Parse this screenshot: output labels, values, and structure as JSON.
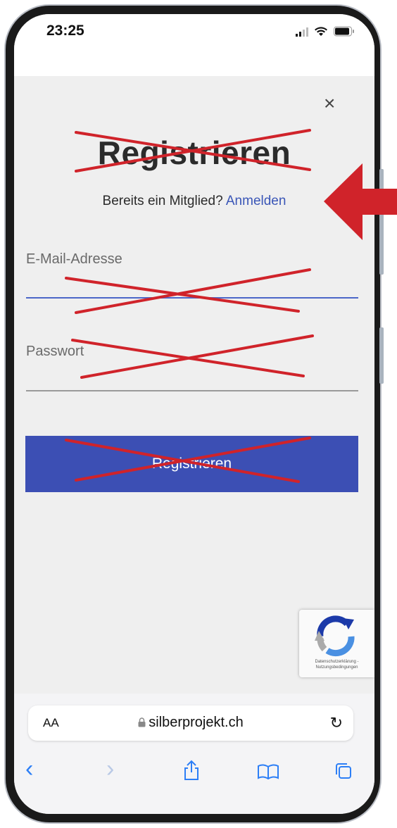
{
  "status_bar": {
    "time": "23:25",
    "icons": [
      "signal-icon",
      "wifi-icon",
      "battery-icon"
    ]
  },
  "form": {
    "close_symbol": "×",
    "title": "Registrieren",
    "member_prompt": "Bereits ein Mitglied?",
    "login_link": "Anmelden",
    "email_label": "E-Mail-Adresse",
    "password_label": "Passwort",
    "submit_label": "Registrieren"
  },
  "recaptcha": {
    "line1": "Datenschutzerklärung -",
    "line2": "Nutzungsbedingungen"
  },
  "browser": {
    "text_size_label": "AA",
    "url": "silberprojekt.ch",
    "reload_symbol": "↻",
    "toolbar": {
      "back_symbol": "‹",
      "forward_symbol": "›",
      "share_symbol": "⇪",
      "bookmarks_symbol": "📖",
      "tabs_symbol": "⧉"
    }
  },
  "annotation": {
    "cross_color": "#d0232a",
    "arrow_color": "#d0232a"
  },
  "colors": {
    "accent": "#3c4fb4",
    "link": "#3a56b7",
    "ios_blue": "#2d7ff6"
  }
}
